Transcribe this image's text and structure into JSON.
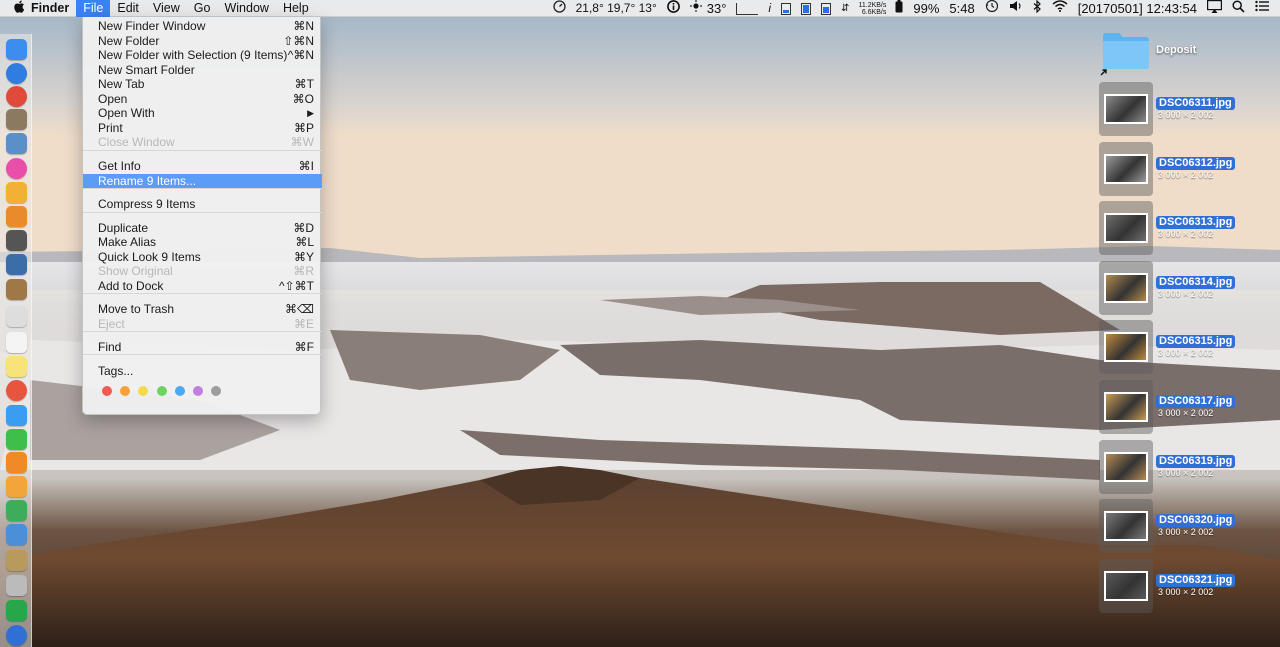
{
  "menubar": {
    "app_name": "Finder",
    "menus": [
      "File",
      "Edit",
      "View",
      "Go",
      "Window",
      "Help"
    ],
    "active_menu": "File"
  },
  "status": {
    "temps": "21,8°  19,7°  13°",
    "info_icon": "info-icon",
    "weather": "33°",
    "net_up": "11.2KB/s",
    "net_down": "6.6KB/s",
    "battery": "99%",
    "time_remaining": "5:48",
    "datetime": "[20170501]  12:43:54"
  },
  "file_menu": {
    "items": [
      {
        "label": "New Finder Window",
        "shortcut": "⌘N",
        "enabled": true
      },
      {
        "label": "New Folder",
        "shortcut": "⇧⌘N",
        "enabled": true
      },
      {
        "label": "New Folder with Selection (9 Items)",
        "shortcut": "^⌘N",
        "enabled": true
      },
      {
        "label": "New Smart Folder",
        "shortcut": "",
        "enabled": true
      },
      {
        "label": "New Tab",
        "shortcut": "⌘T",
        "enabled": true
      },
      {
        "label": "Open",
        "shortcut": "⌘O",
        "enabled": true
      },
      {
        "label": "Open With",
        "shortcut": "▶",
        "enabled": true
      },
      {
        "label": "Print",
        "shortcut": "⌘P",
        "enabled": true
      },
      {
        "label": "Close Window",
        "shortcut": "⌘W",
        "enabled": false
      },
      {
        "label": "Get Info",
        "shortcut": "⌘I",
        "enabled": true
      },
      {
        "label": "Rename 9 Items...",
        "shortcut": "",
        "enabled": true,
        "highlighted": true
      },
      {
        "label": "Compress 9 Items",
        "shortcut": "",
        "enabled": true
      },
      {
        "label": "Duplicate",
        "shortcut": "⌘D",
        "enabled": true
      },
      {
        "label": "Make Alias",
        "shortcut": "⌘L",
        "enabled": true
      },
      {
        "label": "Quick Look 9 Items",
        "shortcut": "⌘Y",
        "enabled": true
      },
      {
        "label": "Show Original",
        "shortcut": "⌘R",
        "enabled": false
      },
      {
        "label": "Add to Dock",
        "shortcut": "^⇧⌘T",
        "enabled": true
      },
      {
        "label": "Move to Trash",
        "shortcut": "⌘⌫",
        "enabled": true
      },
      {
        "label": "Eject",
        "shortcut": "⌘E",
        "enabled": false
      },
      {
        "label": "Find",
        "shortcut": "⌘F",
        "enabled": true
      },
      {
        "label": "Tags...",
        "shortcut": "",
        "enabled": true
      }
    ],
    "tag_colors": [
      "#f05b51",
      "#f7a236",
      "#f4d94a",
      "#6cd45e",
      "#4aa9f0",
      "#c27ee0",
      "#9c9c9c"
    ]
  },
  "desktop": {
    "folder": {
      "name": "Deposit",
      "icon": "folder-icon"
    },
    "files": [
      {
        "name": "DSC06311.jpg",
        "dims": "3 000 × 2 002"
      },
      {
        "name": "DSC06312.jpg",
        "dims": "3 000 × 2 002"
      },
      {
        "name": "DSC06313.jpg",
        "dims": "3 000 × 2 002"
      },
      {
        "name": "DSC06314.jpg",
        "dims": "3 000 × 2 002"
      },
      {
        "name": "DSC06315.jpg",
        "dims": "3 000 × 2 002"
      },
      {
        "name": "DSC06317.jpg",
        "dims": "3 000 × 2 002"
      },
      {
        "name": "DSC06319.jpg",
        "dims": "3 000 × 2 002"
      },
      {
        "name": "DSC06320.jpg",
        "dims": "3 000 × 2 002"
      },
      {
        "name": "DSC06321.jpg",
        "dims": "3 000 × 2 002"
      }
    ]
  },
  "dock": {
    "apps": [
      {
        "name": "finder-icon",
        "color": "#3a8ef0"
      },
      {
        "name": "safari-icon",
        "color": "#2f7de0"
      },
      {
        "name": "chrome-icon",
        "color": "#e04a3a"
      },
      {
        "name": "box-icon",
        "color": "#8b7a60"
      },
      {
        "name": "preview-icon",
        "color": "#5a8fc8"
      },
      {
        "name": "itunes-icon",
        "color": "#e94ea8"
      },
      {
        "name": "photos-icon",
        "color": "#f2b035"
      },
      {
        "name": "image-app-icon",
        "color": "#e98a2c"
      },
      {
        "name": "final-cut-icon",
        "color": "#555"
      },
      {
        "name": "video-app-icon",
        "color": "#3b6ea8"
      },
      {
        "name": "notebook-icon",
        "color": "#a07848"
      },
      {
        "name": "text-edit-icon",
        "color": "#ddd"
      },
      {
        "name": "calendar-icon",
        "color": "#f4f4f4"
      },
      {
        "name": "notes-icon",
        "color": "#f8e27a"
      },
      {
        "name": "google-icon",
        "color": "#e8553f"
      },
      {
        "name": "messages-icon",
        "color": "#3b9df0"
      },
      {
        "name": "facetime-icon",
        "color": "#3fbf4a"
      },
      {
        "name": "ibooks-icon",
        "color": "#f08a24"
      },
      {
        "name": "pages-icon",
        "color": "#f3a53c"
      },
      {
        "name": "numbers-icon",
        "color": "#3cae5a"
      },
      {
        "name": "keynote-icon",
        "color": "#4b8fd8"
      },
      {
        "name": "archive-icon",
        "color": "#b89a5c"
      },
      {
        "name": "preferences-icon",
        "color": "#bbb"
      },
      {
        "name": "skype-icon",
        "color": "#27a64a"
      },
      {
        "name": "onepassword-icon",
        "color": "#2f6fd6"
      }
    ]
  }
}
